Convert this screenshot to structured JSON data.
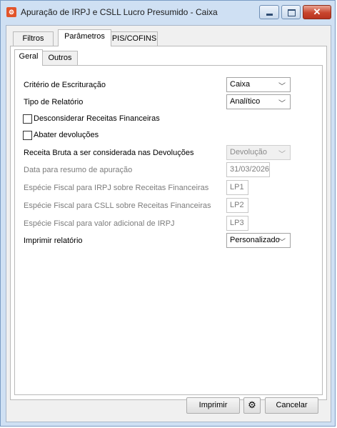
{
  "window": {
    "title": "Apuração de IRPJ e CSLL Lucro Presumido - Caixa"
  },
  "tabs": [
    {
      "label": "Filtros"
    },
    {
      "label": "Parâmetros"
    },
    {
      "label": "PIS/COFINS"
    }
  ],
  "subtabs": [
    {
      "label": "Geral"
    },
    {
      "label": "Outros"
    }
  ],
  "form": {
    "criterio_label": "Critério de Escrituração",
    "criterio_value": "Caixa",
    "tipo_label": "Tipo de Relatório",
    "tipo_value": "Analítico",
    "desconsiderar_label": "Desconsiderar Receitas Financeiras",
    "abater_label": "Abater devoluções",
    "receita_label": "Receita Bruta a ser considerada nas Devoluções",
    "receita_value": "Devolução",
    "data_label": "Data para resumo de apuração",
    "data_value": "31/03/2026",
    "irpj_label": "Espécie Fiscal para IRPJ sobre Receitas Financeiras",
    "irpj_value": "LP1",
    "csll_label": "Espécie Fiscal para CSLL sobre Receitas Financeiras",
    "csll_value": "LP2",
    "adicional_label": "Espécie Fiscal para valor adicional de IRPJ",
    "adicional_value": "LP3",
    "imprimir_label": "Imprimir relatório",
    "imprimir_value": "Personalizado"
  },
  "footer": {
    "imprimir_button": "Imprimir",
    "cancelar_button": "Cancelar"
  },
  "icons": {
    "app": "app-icon",
    "settings": "gear-icon",
    "chevron": "chevron-down-icon"
  }
}
